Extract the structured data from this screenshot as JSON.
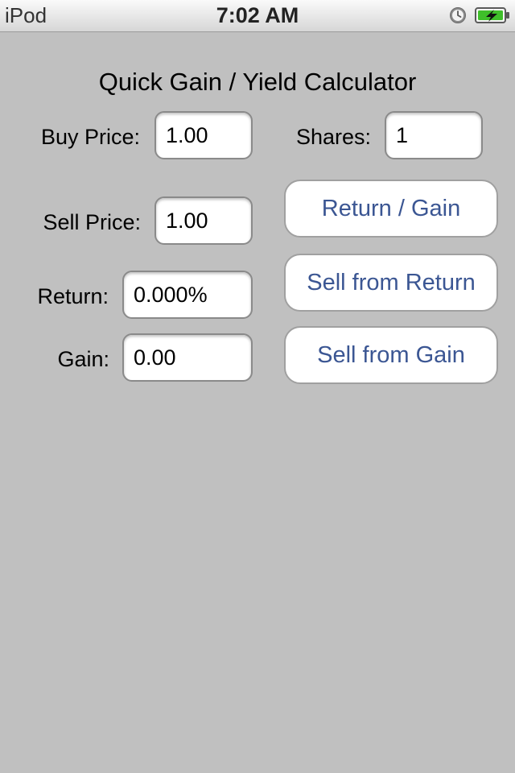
{
  "status_bar": {
    "carrier": "iPod",
    "time": "7:02 AM",
    "icons": [
      "alarm-icon",
      "battery-charging-icon"
    ]
  },
  "title": "Quick Gain / Yield Calculator",
  "fields": {
    "buy_price": {
      "label": "Buy Price:",
      "value": "1.00"
    },
    "shares": {
      "label": "Shares:",
      "value": "1"
    },
    "sell_price": {
      "label": "Sell Price:",
      "value": "1.00"
    },
    "return": {
      "label": "Return:",
      "value": "0.000%"
    },
    "gain": {
      "label": "Gain:",
      "value": "0.00"
    }
  },
  "buttons": {
    "return_gain": "Return / Gain",
    "sell_from_return": "Sell from Return",
    "sell_from_gain": "Sell from Gain"
  },
  "colors": {
    "background": "#c0c0c0",
    "button_text": "#3b5693",
    "battery_fill": "#3fbf2a"
  }
}
